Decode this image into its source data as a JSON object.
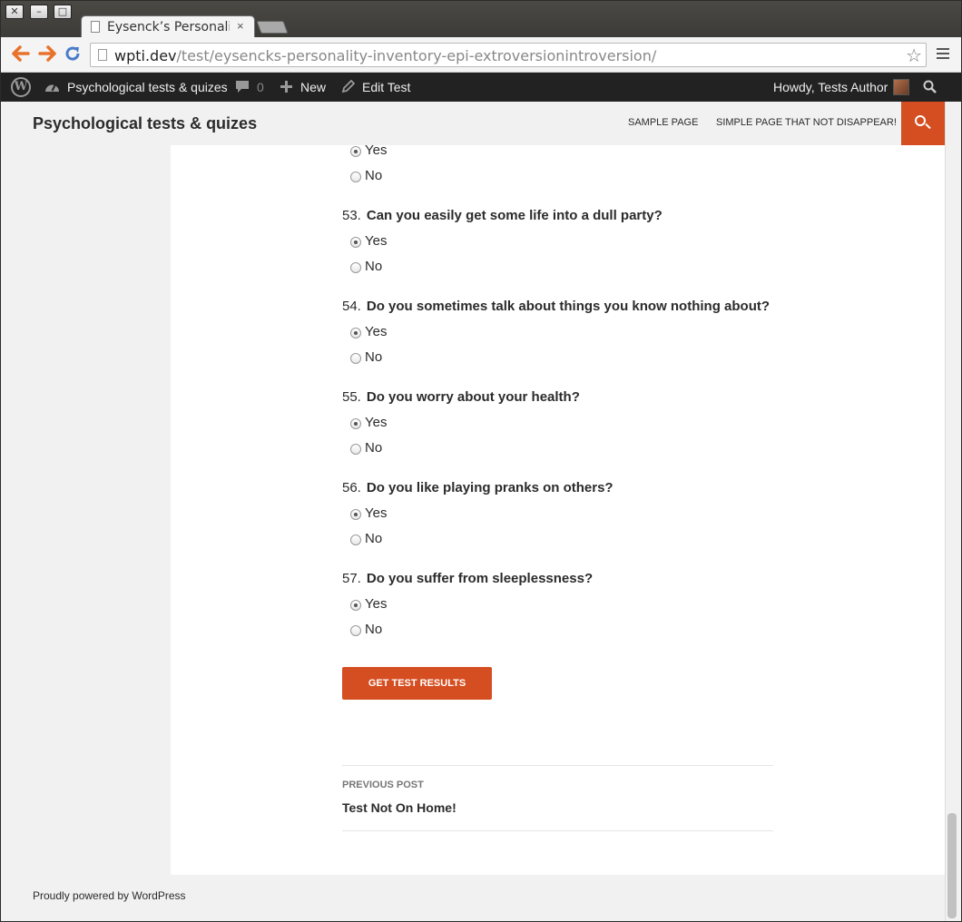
{
  "browser": {
    "tab_title": "Eysenck’s Personality",
    "tab_close": "×",
    "url_host": "wpti.dev",
    "url_path": "/test/eysencks-personality-inventory-epi-extroversionintroversion/",
    "star": "☆",
    "win_close": "✕",
    "win_min": "–",
    "win_max": "□"
  },
  "adminbar": {
    "site_name": "Psychological tests & quizes",
    "comments_count": "0",
    "new_label": "New",
    "edit_label": "Edit Test",
    "howdy": "Howdy, Tests Author"
  },
  "header": {
    "site_title": "Psychological tests & quizes",
    "menu": [
      "SAMPLE PAGE",
      "SIMPLE PAGE THAT NOT DISAPPEAR!"
    ]
  },
  "prev_question": {
    "options": [
      {
        "label": "Yes",
        "checked": true
      },
      {
        "label": "No",
        "checked": false
      }
    ]
  },
  "questions": [
    {
      "number": "53.",
      "text": "Can you easily get some life into a dull party?",
      "options": [
        {
          "label": "Yes",
          "checked": true
        },
        {
          "label": "No",
          "checked": false
        }
      ]
    },
    {
      "number": "54.",
      "text": "Do you sometimes talk about things you know nothing about?",
      "options": [
        {
          "label": "Yes",
          "checked": true
        },
        {
          "label": "No",
          "checked": false
        }
      ]
    },
    {
      "number": "55.",
      "text": "Do you worry about your health?",
      "options": [
        {
          "label": "Yes",
          "checked": true
        },
        {
          "label": "No",
          "checked": false
        }
      ]
    },
    {
      "number": "56.",
      "text": "Do you like playing pranks on others?",
      "options": [
        {
          "label": "Yes",
          "checked": true
        },
        {
          "label": "No",
          "checked": false
        }
      ]
    },
    {
      "number": "57.",
      "text": "Do you suffer from sleeplessness?",
      "options": [
        {
          "label": "Yes",
          "checked": true
        },
        {
          "label": "No",
          "checked": false
        }
      ]
    }
  ],
  "submit_label": "GET TEST RESULTS",
  "post_nav": {
    "label": "PREVIOUS POST",
    "title": "Test Not On Home!"
  },
  "footer": "Proudly powered by WordPress"
}
